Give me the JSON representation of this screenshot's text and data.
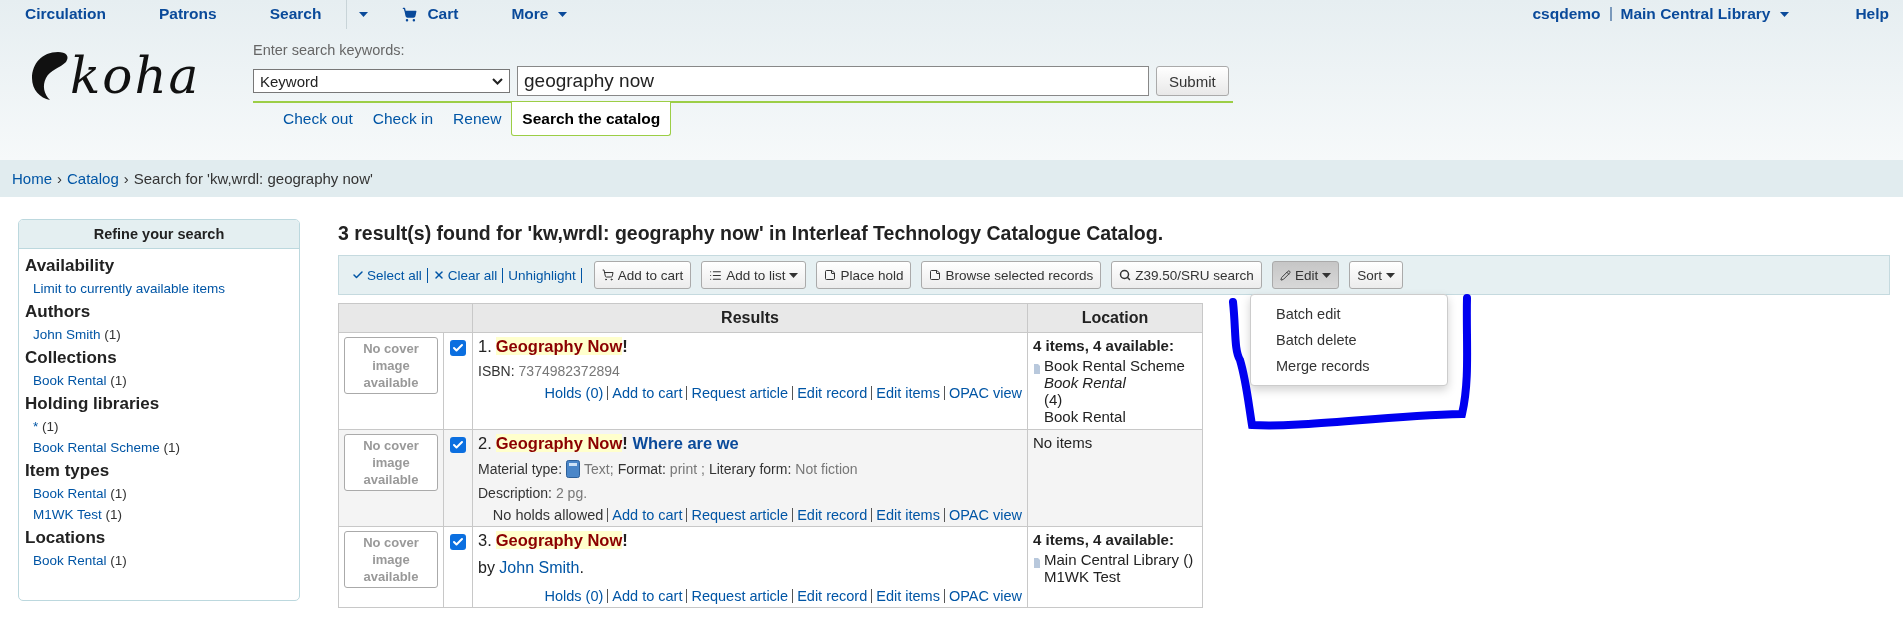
{
  "top_nav": {
    "items": [
      {
        "label": "Circulation",
        "kind": "link"
      },
      {
        "label": "Patrons",
        "kind": "link"
      },
      {
        "label": "Search",
        "kind": "link"
      },
      {
        "kind": "caret"
      },
      {
        "label": "Cart",
        "kind": "cart"
      },
      {
        "label": "More",
        "kind": "menu"
      }
    ],
    "user": "csqdemo",
    "library": "Main Central Library",
    "help": "Help"
  },
  "logo": {
    "text": "koha"
  },
  "search": {
    "label": "Enter search keywords:",
    "index": "Keyword",
    "value": "geography now",
    "submit": "Submit"
  },
  "search_tabs": [
    {
      "label": "Check out",
      "selected": false
    },
    {
      "label": "Check in",
      "selected": false
    },
    {
      "label": "Renew",
      "selected": false
    },
    {
      "label": "Search the catalog",
      "selected": true
    }
  ],
  "breadcrumb": [
    {
      "label": "Home",
      "kind": "link"
    },
    {
      "label": "›",
      "kind": "sep"
    },
    {
      "label": "Catalog",
      "kind": "link"
    },
    {
      "label": "›",
      "kind": "sep"
    },
    {
      "label": "Search for 'kw,wrdl: geography now'",
      "kind": "text"
    }
  ],
  "refine": {
    "title": "Refine your search",
    "sections": [
      {
        "heading": "Availability",
        "items": [
          {
            "label": "Limit to currently available items"
          }
        ]
      },
      {
        "heading": "Authors",
        "items": [
          {
            "label": "John Smith",
            "count": "(1)"
          }
        ]
      },
      {
        "heading": "Collections",
        "items": [
          {
            "label": "Book Rental",
            "count": "(1)"
          }
        ]
      },
      {
        "heading": "Holding libraries",
        "items": [
          {
            "label": "*",
            "count": "(1)"
          },
          {
            "label": "Book Rental Scheme",
            "count": "(1)"
          }
        ]
      },
      {
        "heading": "Item types",
        "items": [
          {
            "label": "Book Rental",
            "count": "(1)"
          },
          {
            "label": "M1WK Test",
            "count": "(1)"
          }
        ]
      },
      {
        "heading": "Locations",
        "items": [
          {
            "label": "Book Rental",
            "count": "(1)"
          }
        ]
      }
    ]
  },
  "results_heading": "3 result(s) found for 'kw,wrdl: geography now' in Interleaf Technology Catalogue Catalog.",
  "toolbar": {
    "links": [
      "Select all",
      "Clear all",
      "Unhighlight"
    ],
    "buttons": [
      {
        "label": "Add to cart",
        "dropdown": false,
        "pressed": false
      },
      {
        "label": "Add to list",
        "dropdown": true,
        "pressed": false
      },
      {
        "label": "Place hold",
        "dropdown": false,
        "pressed": false
      },
      {
        "label": "Browse selected records",
        "dropdown": false,
        "pressed": false
      },
      {
        "label": "Z39.50/SRU search",
        "dropdown": false,
        "pressed": false
      },
      {
        "label": "Edit",
        "dropdown": true,
        "pressed": true
      },
      {
        "label": "Sort",
        "dropdown": true,
        "pressed": false
      }
    ]
  },
  "edit_menu": [
    "Batch edit",
    "Batch delete",
    "Merge records"
  ],
  "table": {
    "columns": [
      "Results",
      "Location"
    ],
    "rows": [
      {
        "cover": "No cover image available",
        "checked": true,
        "number": "1.",
        "title": "Geography Now",
        "title_rest": "!",
        "details": [
          {
            "kind": "isbn",
            "label": "ISBN:",
            "value": "7374982372894"
          }
        ],
        "actions": [
          {
            "label": "Holds (0)",
            "kind": "link"
          },
          {
            "label": "Add to cart",
            "kind": "link"
          },
          {
            "label": "Request article",
            "kind": "link"
          },
          {
            "label": "Edit record",
            "kind": "link"
          },
          {
            "label": "Edit items",
            "kind": "link"
          },
          {
            "label": "OPAC view",
            "kind": "link"
          }
        ],
        "location": {
          "summary": "4 items, 4 available:",
          "lines": [
            {
              "text": "Book Rental Scheme",
              "italic": false
            },
            {
              "text": "Book Rental",
              "italic": true
            },
            {
              "text": "(4)",
              "italic": false
            },
            {
              "text": "Book Rental",
              "italic": false
            }
          ]
        }
      },
      {
        "cover": "No cover image available",
        "checked": true,
        "number": "2.",
        "title": "Geography Now",
        "title_rest": "!",
        "subtitle": "Where are we",
        "details": [
          {
            "kind": "material",
            "label": "Material type:",
            "value": "Text;",
            "format_label": "Format:",
            "format": "print ;",
            "form_label": "Literary form:",
            "form": "Not fiction"
          },
          {
            "kind": "description",
            "label": "Description:",
            "value": "2 pg."
          }
        ],
        "actions": [
          {
            "label": "No holds allowed",
            "kind": "text"
          },
          {
            "label": "Add to cart",
            "kind": "link"
          },
          {
            "label": "Request article",
            "kind": "link"
          },
          {
            "label": "Edit record",
            "kind": "link"
          },
          {
            "label": "Edit items",
            "kind": "link"
          },
          {
            "label": "OPAC view",
            "kind": "link"
          }
        ],
        "location": {
          "none": "No items"
        }
      },
      {
        "cover": "No cover image available",
        "checked": true,
        "number": "3.",
        "title": "Geography Now",
        "title_rest": "!",
        "details": [
          {
            "kind": "author",
            "label": "by",
            "value": "John Smith",
            "suffix": "."
          }
        ],
        "actions": [
          {
            "label": "Holds (0)",
            "kind": "link"
          },
          {
            "label": "Add to cart",
            "kind": "link"
          },
          {
            "label": "Request article",
            "kind": "link"
          },
          {
            "label": "Edit record",
            "kind": "link"
          },
          {
            "label": "Edit items",
            "kind": "link"
          },
          {
            "label": "OPAC view",
            "kind": "link"
          }
        ],
        "location": {
          "summary": "4 items, 4 available:",
          "lines": [
            {
              "text": "Main Central Library ()",
              "italic": false
            },
            {
              "text": "M1WK Test",
              "italic": false
            }
          ]
        }
      }
    ]
  }
}
